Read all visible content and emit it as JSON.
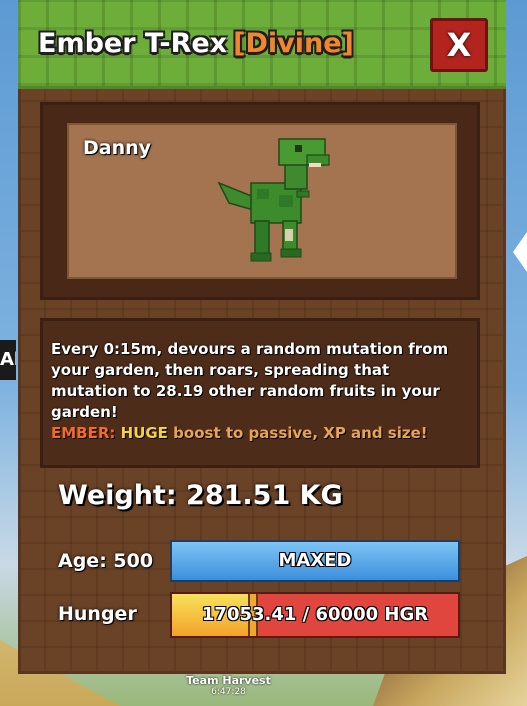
{
  "window": {
    "title": "Ember T-Rex",
    "rarity": "[Divine]",
    "close_label": "X"
  },
  "pet": {
    "name": "Danny",
    "color": "#2f7a26"
  },
  "description": {
    "text": "Every 0:15m, devours a random mutation from your garden, then roars, spreading that mutation to 28.19 other random fruits in your garden!",
    "ember_label": "EMBER:",
    "ember_huge": "HUGE",
    "ember_rest": "boost to passive, XP and size!"
  },
  "stats": {
    "weight": "Weight: 281.51 KG",
    "age_label": "Age: 500",
    "age_bar_text": "MAXED",
    "hunger_label": "Hunger",
    "hunger_text": "17053.41 / 60000 HGR",
    "hunger_fraction": 0.284
  },
  "background": {
    "left_edge_text": "Al",
    "team_name": "Team Harvest",
    "time": "6:47:28"
  },
  "colors": {
    "header_green": "#6dae3a",
    "panel_brown": "#6a4226",
    "close_red": "#b3241e",
    "rarity_orange": "#f2862f",
    "age_blue": "#3d8fdc",
    "hunger_red": "#e0453e",
    "hunger_yellow": "#f7e25a"
  }
}
